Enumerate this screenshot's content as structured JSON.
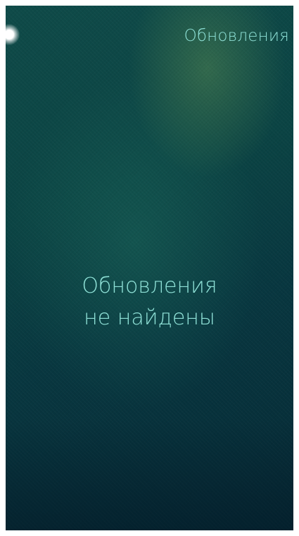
{
  "header": {
    "title": "Обновления"
  },
  "empty_state": {
    "line1": "Обновления",
    "line2": "не найдены"
  },
  "colors": {
    "accent_text": "#8ee0d6",
    "background_dark": "#062a36",
    "background_teal": "#0f4b49"
  },
  "icons": {
    "pulley_indicator": "pulley-menu-indicator-icon"
  }
}
